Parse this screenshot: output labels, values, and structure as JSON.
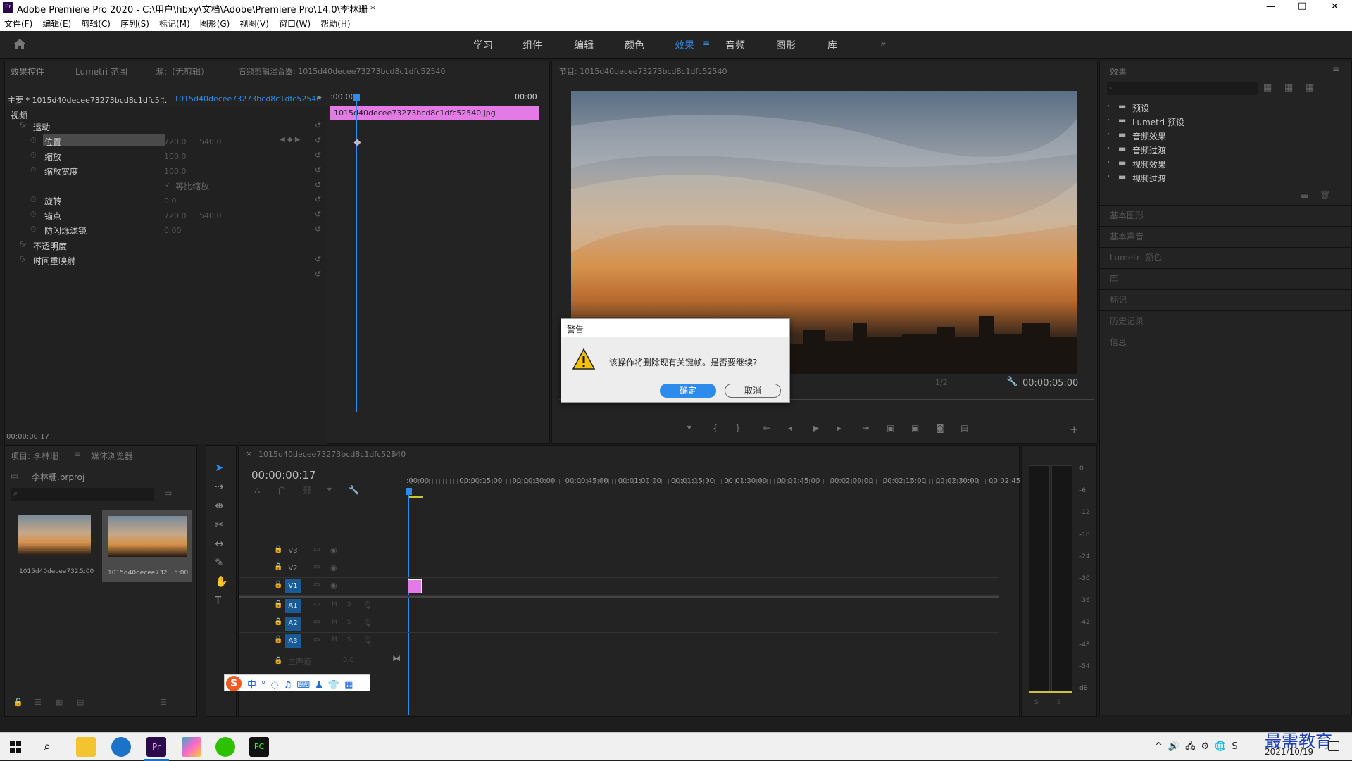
{
  "window": {
    "title": "Adobe Premiere Pro 2020 - C:\\用户\\hbxy\\文档\\Adobe\\Premiere Pro\\14.0\\李林珊 *",
    "minimize": "—",
    "maximize": "□",
    "close": "✕"
  },
  "menu": [
    "文件(F)",
    "编辑(E)",
    "剪辑(C)",
    "序列(S)",
    "标记(M)",
    "图形(G)",
    "视图(V)",
    "窗口(W)",
    "帮助(H)"
  ],
  "workspaces": [
    "学习",
    "组件",
    "编辑",
    "颜色",
    "效果",
    "音频",
    "图形",
    "库"
  ],
  "workspace_active": "效果",
  "effect_controls": {
    "tabs": [
      "效果控件",
      "Lumetri 范围",
      "源:（无剪辑）",
      "音频剪辑混合器: 1015d40decee73273bcd8c1dfc52540"
    ],
    "master": "主要 * 1015d40decee73273bcd8c1dfc5...",
    "clip": "1015d40decee73273bcd8c1dfc52540 ...",
    "time_start": ":00:00",
    "time_end": "00:00",
    "clip_bar": "1015d40decee73273bcd8c1dfc52540.jpg",
    "section_video": "视频",
    "motion": "运动",
    "props": [
      {
        "name": "位置",
        "v1": "720.0",
        "v2": "540.0"
      },
      {
        "name": "缩放",
        "v1": "100.0",
        "v2": ""
      },
      {
        "name": "缩放宽度",
        "v1": "100.0",
        "v2": ""
      },
      {
        "name": "等比缩放",
        "v1": "",
        "v2": ""
      },
      {
        "name": "旋转",
        "v1": "0.0",
        "v2": ""
      },
      {
        "name": "锚点",
        "v1": "720.0",
        "v2": "540.0"
      },
      {
        "name": "防闪烁滤镜",
        "v1": "0.00",
        "v2": ""
      }
    ],
    "opacity": "不透明度",
    "time_remap": "时间重映射",
    "timecode": "00:00:00:17"
  },
  "program": {
    "title": "节目: 1015d40decee73273bcd8c1dfc52540",
    "timecode": "00:00:05:00",
    "fraction": "1/2"
  },
  "effects_panel": {
    "title": "效果",
    "items": [
      "预设",
      "Lumetri 预设",
      "音频效果",
      "音频过渡",
      "视频效果",
      "视频过渡"
    ],
    "sections": [
      "基本图形",
      "基本声音",
      "Lumetri 颜色",
      "库",
      "标记",
      "历史记录",
      "信息"
    ]
  },
  "dialog": {
    "title": "警告",
    "message": "该操作将删除现有关键帧。是否要继续?",
    "ok": "确定",
    "cancel": "取消"
  },
  "project": {
    "tabs": [
      "项目: 李林珊",
      "媒体浏览器"
    ],
    "file": "李林珊.prproj",
    "items": [
      {
        "name": "1015d40decee732...",
        "dur": "5:00"
      },
      {
        "name": "1015d40decee732...",
        "dur": "5:00"
      }
    ]
  },
  "timeline": {
    "title": "1015d40decee73273bcd8c1dfc52540",
    "close": "×",
    "timecode": "00:00:00:17",
    "ruler": [
      ":00:00",
      "00:00:15:00",
      "00:00:30:00",
      "00:00:45:00",
      "00:01:00:00",
      "00:01:15:00",
      "00:01:30:00",
      "00:01:45:00",
      "00:02:00:00",
      "00:02:15:00",
      "00:02:30:00",
      "00:02:45:"
    ],
    "video_tracks": [
      "V3",
      "V2",
      "V1"
    ],
    "audio_tracks": [
      "A1",
      "A2",
      "A3"
    ],
    "master": "主声道",
    "master_val": "0.0"
  },
  "meter": {
    "labels": [
      "0",
      "-6",
      "-12",
      "-18",
      "-24",
      "-30",
      "-36",
      "-42",
      "-48",
      "-54",
      "dB"
    ],
    "solo": [
      "S",
      "S"
    ]
  },
  "taskbar": {
    "date": "2021/10/19",
    "watermark": "最需教育"
  },
  "colors": {
    "accent": "#2d8ceb",
    "clip": "#e37ae6",
    "track_active": "#1b5a93"
  }
}
